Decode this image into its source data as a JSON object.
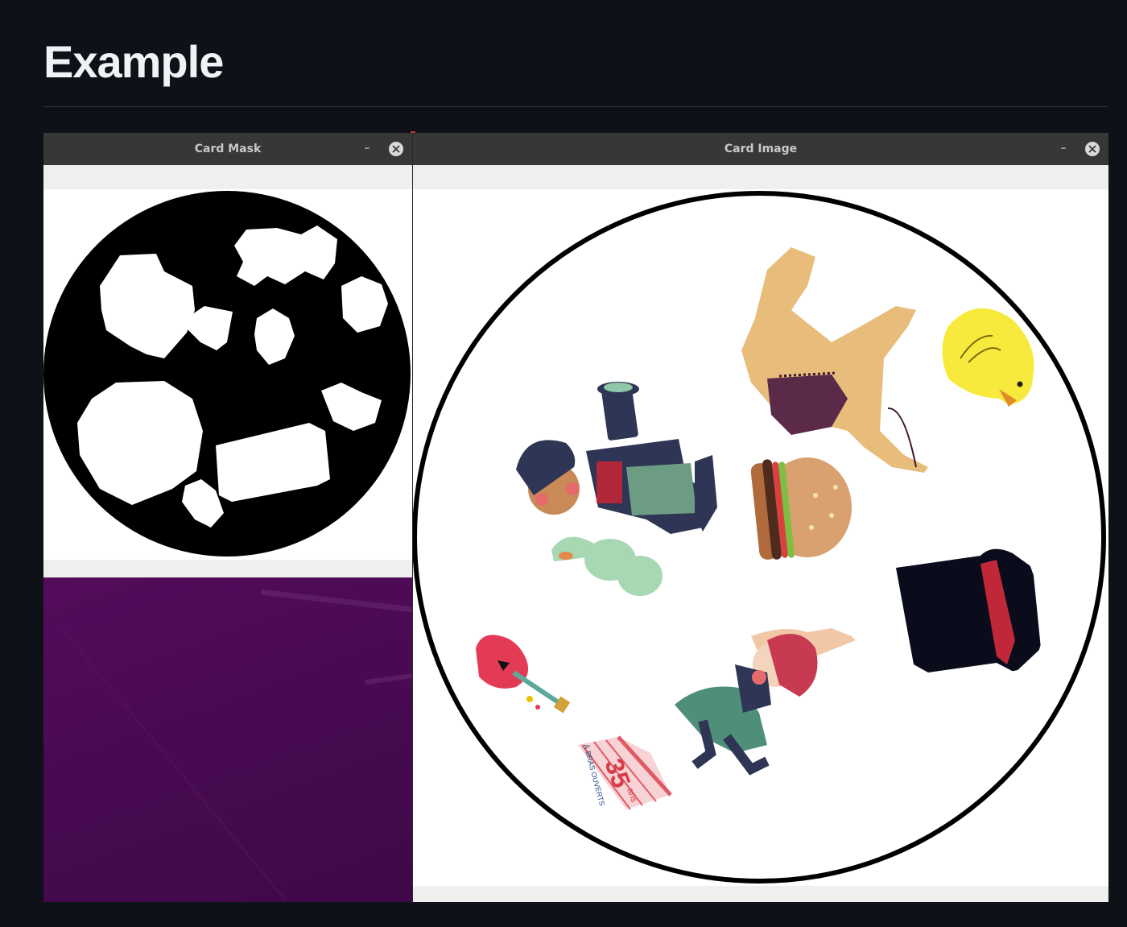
{
  "page": {
    "heading": "Example"
  },
  "windows": {
    "mask": {
      "title": "Card Mask",
      "minimize_glyph": "–"
    },
    "image": {
      "title": "Card Image",
      "minimize_glyph": "–"
    }
  },
  "card_image": {
    "sign_number": "35",
    "sign_small": "ans",
    "sign_banner": "À BRAS OUVERTS"
  },
  "icons": [
    "minimize-icon",
    "close-icon"
  ],
  "colors": {
    "page_background": "#0e1117",
    "titlebar": "#373737",
    "desktop": "#4a0a52",
    "mask_black": "#000000",
    "mask_white": "#ffffff"
  }
}
